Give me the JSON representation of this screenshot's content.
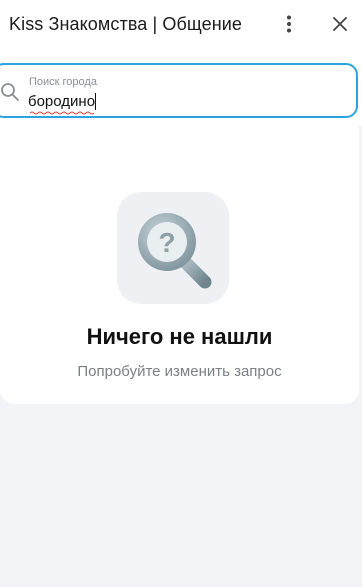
{
  "header": {
    "title": "Kiss Знакомства | Общение",
    "more_icon": "more-vertical-icon",
    "close_icon": "close-icon"
  },
  "search": {
    "label": "Поиск города",
    "value": "бородино",
    "icon": "search-icon",
    "accent_color": "#2aa3e0"
  },
  "empty_state": {
    "icon": "magnifier-question-icon",
    "title": "Ничего не нашли",
    "subtitle": "Попробуйте изменить запрос"
  }
}
